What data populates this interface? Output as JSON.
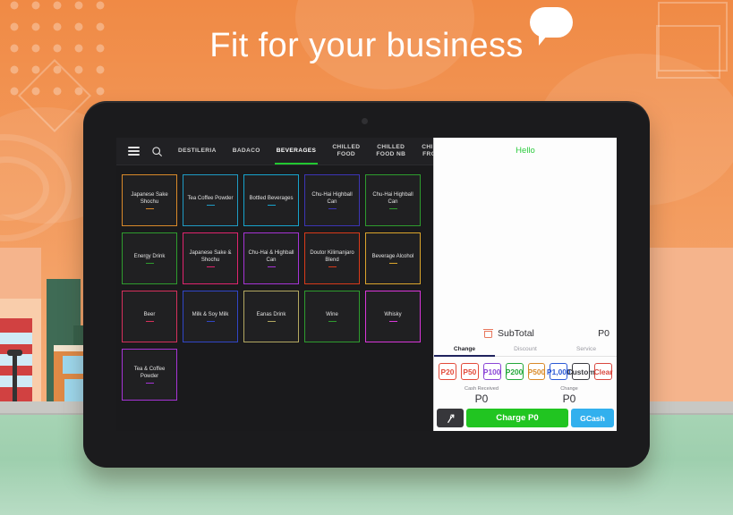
{
  "promo": {
    "headline": "Fit for your business",
    "bubble_icon": "speech-bubble-icon"
  },
  "app": {
    "topbar": {
      "menu_icon": "hamburger-menu-icon",
      "search_icon": "search-icon",
      "tabs": [
        {
          "label": "DESTILERIA",
          "active": false
        },
        {
          "label": "BADACO",
          "active": false
        },
        {
          "label": "BEVERAGES",
          "active": true
        },
        {
          "label": "CHILLED\nFOOD",
          "active": false
        },
        {
          "label": "CHILLED\nFOOD NB",
          "active": false
        },
        {
          "label": "CHILLED\nFROZEN",
          "active": false
        }
      ],
      "active_tab_color": "#22c831"
    },
    "catalog": {
      "tiles": [
        {
          "label": "Japanese Sake Shochu",
          "color": "#d9892a"
        },
        {
          "label": "Tea  Coffee Powder",
          "color": "#1f9bc4"
        },
        {
          "label": "Bottled Beverages",
          "color": "#16a3cd"
        },
        {
          "label": "Chu-Hai Highball Can",
          "color": "#3c35b5"
        },
        {
          "label": "Chu-Hai Highball Can",
          "color": "#2e9c2e"
        },
        {
          "label": "Energy Drink",
          "color": "#2e9c2e"
        },
        {
          "label": "Japanese Sake & Shochu",
          "color": "#e0246e"
        },
        {
          "label": "Chu-Hai & Highball Can",
          "color": "#a634d6"
        },
        {
          "label": "Doutor Kilimanjaro Blend",
          "color": "#d93a1a"
        },
        {
          "label": "Beverage Alcohol",
          "color": "#dba52c"
        },
        {
          "label": "Beer",
          "color": "#d6305c"
        },
        {
          "label": "Milk & Soy Milk",
          "color": "#3146c7"
        },
        {
          "label": "Eanas Drink",
          "color": "#b3a861"
        },
        {
          "label": "Wine",
          "color": "#2e9c2e"
        },
        {
          "label": "Whisky",
          "color": "#d936d9"
        },
        {
          "label": "Tea & Coffee Powder",
          "color": "#a634d6"
        }
      ]
    },
    "cart": {
      "greeting": "Hello",
      "greeting_color": "#2ecc40",
      "trash_icon": "trash-icon",
      "subtotal_label": "SubTotal",
      "subtotal_amount": "P0",
      "mode_tabs": [
        {
          "label": "Change",
          "active": true
        },
        {
          "label": "Discount",
          "active": false
        },
        {
          "label": "Service",
          "active": false
        }
      ],
      "denominations": [
        {
          "label": "P20",
          "color": "#e34b3a"
        },
        {
          "label": "P50",
          "color": "#e34b3a"
        },
        {
          "label": "P100",
          "color": "#8b45d6"
        },
        {
          "label": "P200",
          "color": "#24a83a"
        },
        {
          "label": "P500",
          "color": "#d98a28"
        },
        {
          "label": "P1,000",
          "color": "#2a58d6"
        },
        {
          "label": "Custom",
          "color": "#3a3a40"
        },
        {
          "label": "Clear",
          "color": "#d9483f"
        }
      ],
      "cash_received_label": "Cash Received",
      "cash_received_value": "P0",
      "change_label": "Change",
      "change_value": "P0",
      "split_icon": "split-branch-icon",
      "charge_label": "Charge P0",
      "gcash_label": "GCash"
    }
  }
}
